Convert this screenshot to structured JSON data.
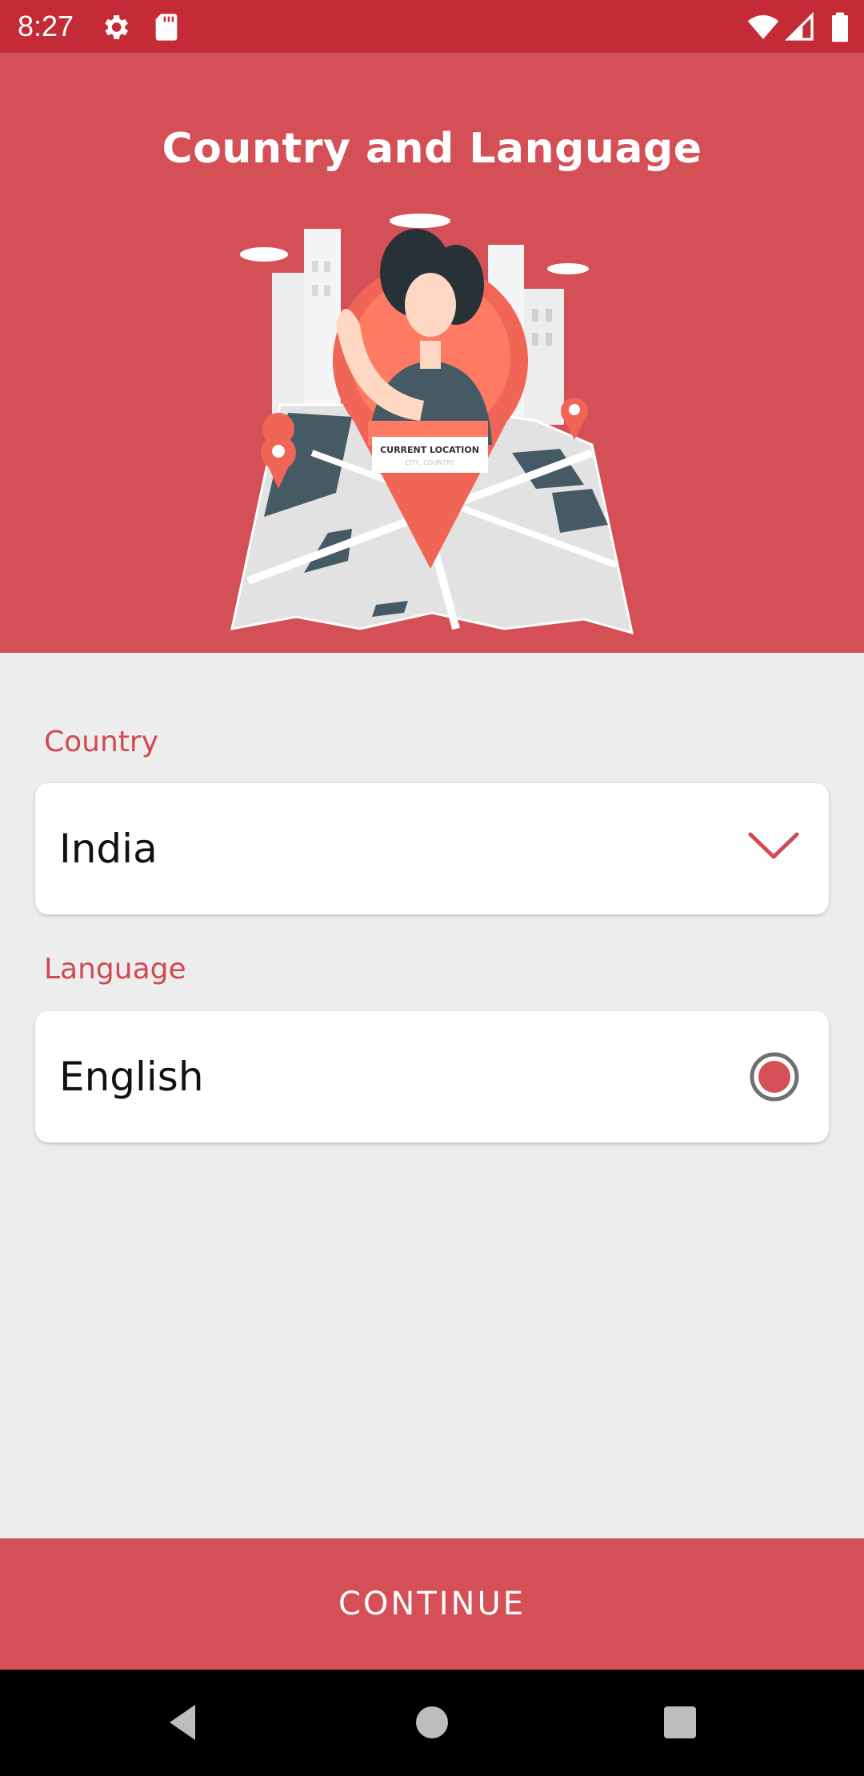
{
  "status_bar": {
    "time": "8:27",
    "icons": [
      "gear-icon",
      "sd-card-icon",
      "wifi-icon",
      "signal-icon",
      "battery-icon"
    ]
  },
  "header": {
    "title": "Country and Language",
    "illustration": {
      "pin_label_line1": "CURRENT LOCATION",
      "pin_label_line2": "CITY, COUNTRY"
    }
  },
  "form": {
    "country": {
      "label": "Country",
      "value": "India",
      "icon": "chevron-down-icon"
    },
    "language": {
      "label": "Language",
      "value": "English",
      "icon": "radio-selected-icon",
      "selected": true
    }
  },
  "continue_label": "CONTINUE",
  "nav": {
    "icons": [
      "back-icon",
      "home-icon",
      "recents-icon"
    ]
  },
  "colors": {
    "status_bar": "#c42b36",
    "accent": "#d54f57",
    "label": "#d04a52",
    "background": "#ededed"
  }
}
